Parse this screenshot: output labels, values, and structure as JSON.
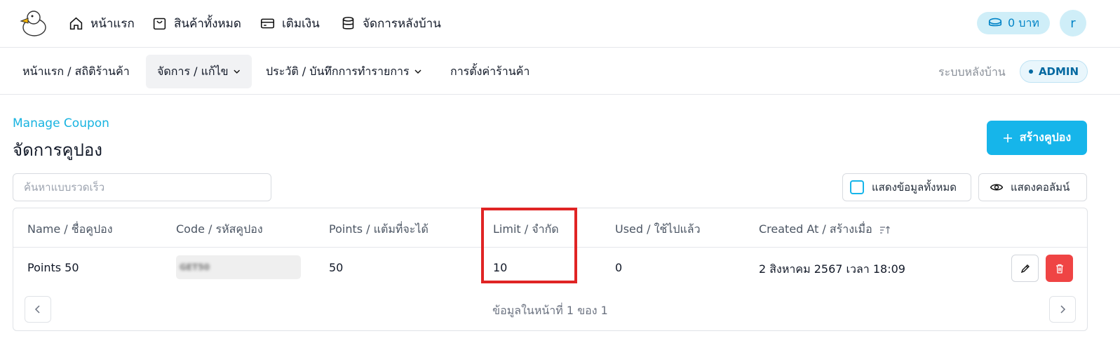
{
  "topnav": {
    "items": [
      {
        "label": "หน้าแรก",
        "icon": "home-icon"
      },
      {
        "label": "สินค้าทั้งหมด",
        "icon": "shopping-bag-icon"
      },
      {
        "label": "เติมเงิน",
        "icon": "credit-card-icon"
      },
      {
        "label": "จัดการหลังบ้าน",
        "icon": "database-icon"
      }
    ],
    "balance": "0 บาท",
    "avatar": "r"
  },
  "subnav": {
    "items": [
      {
        "label": "หน้าแรก / สถิติร้านค้า"
      },
      {
        "label": "จัดการ / แก้ไข",
        "active": true
      },
      {
        "label": "ประวัติ / บันทึกการทำรายการ"
      },
      {
        "label": "การตั้งค่าร้านค้า"
      }
    ],
    "system_label": "ระบบหลังบ้าน",
    "role_badge": "ADMIN"
  },
  "page": {
    "eyebrow": "Manage Coupon",
    "title": "จัดการคูปอง",
    "create_button": "สร้างคูปอง"
  },
  "toolbar": {
    "search_placeholder": "ค้นหาแบบรวดเร็ว",
    "show_all_label": "แสดงข้อมูลทั้งหมด",
    "show_columns_label": "แสดงคอลัมน์"
  },
  "table": {
    "columns": [
      "Name / ชื่อคูปอง",
      "Code / รหัสคูปอง",
      "Points / แต้มที่จะได้",
      "Limit / จำกัด",
      "Used / ใช้ไปแล้ว",
      "Created At / สร้างเมื่อ"
    ],
    "rows": [
      {
        "name": "Points 50",
        "code": "GET50",
        "points": "50",
        "limit": "10",
        "used": "0",
        "created_at": "2 สิงหาคม 2567 เวลา 18:09"
      }
    ],
    "pagination": "ข้อมูลในหน้าที่ 1 ของ 1"
  },
  "colors": {
    "accent": "#16b5ea",
    "highlight": "#e02424",
    "danger": "#ef4444"
  }
}
